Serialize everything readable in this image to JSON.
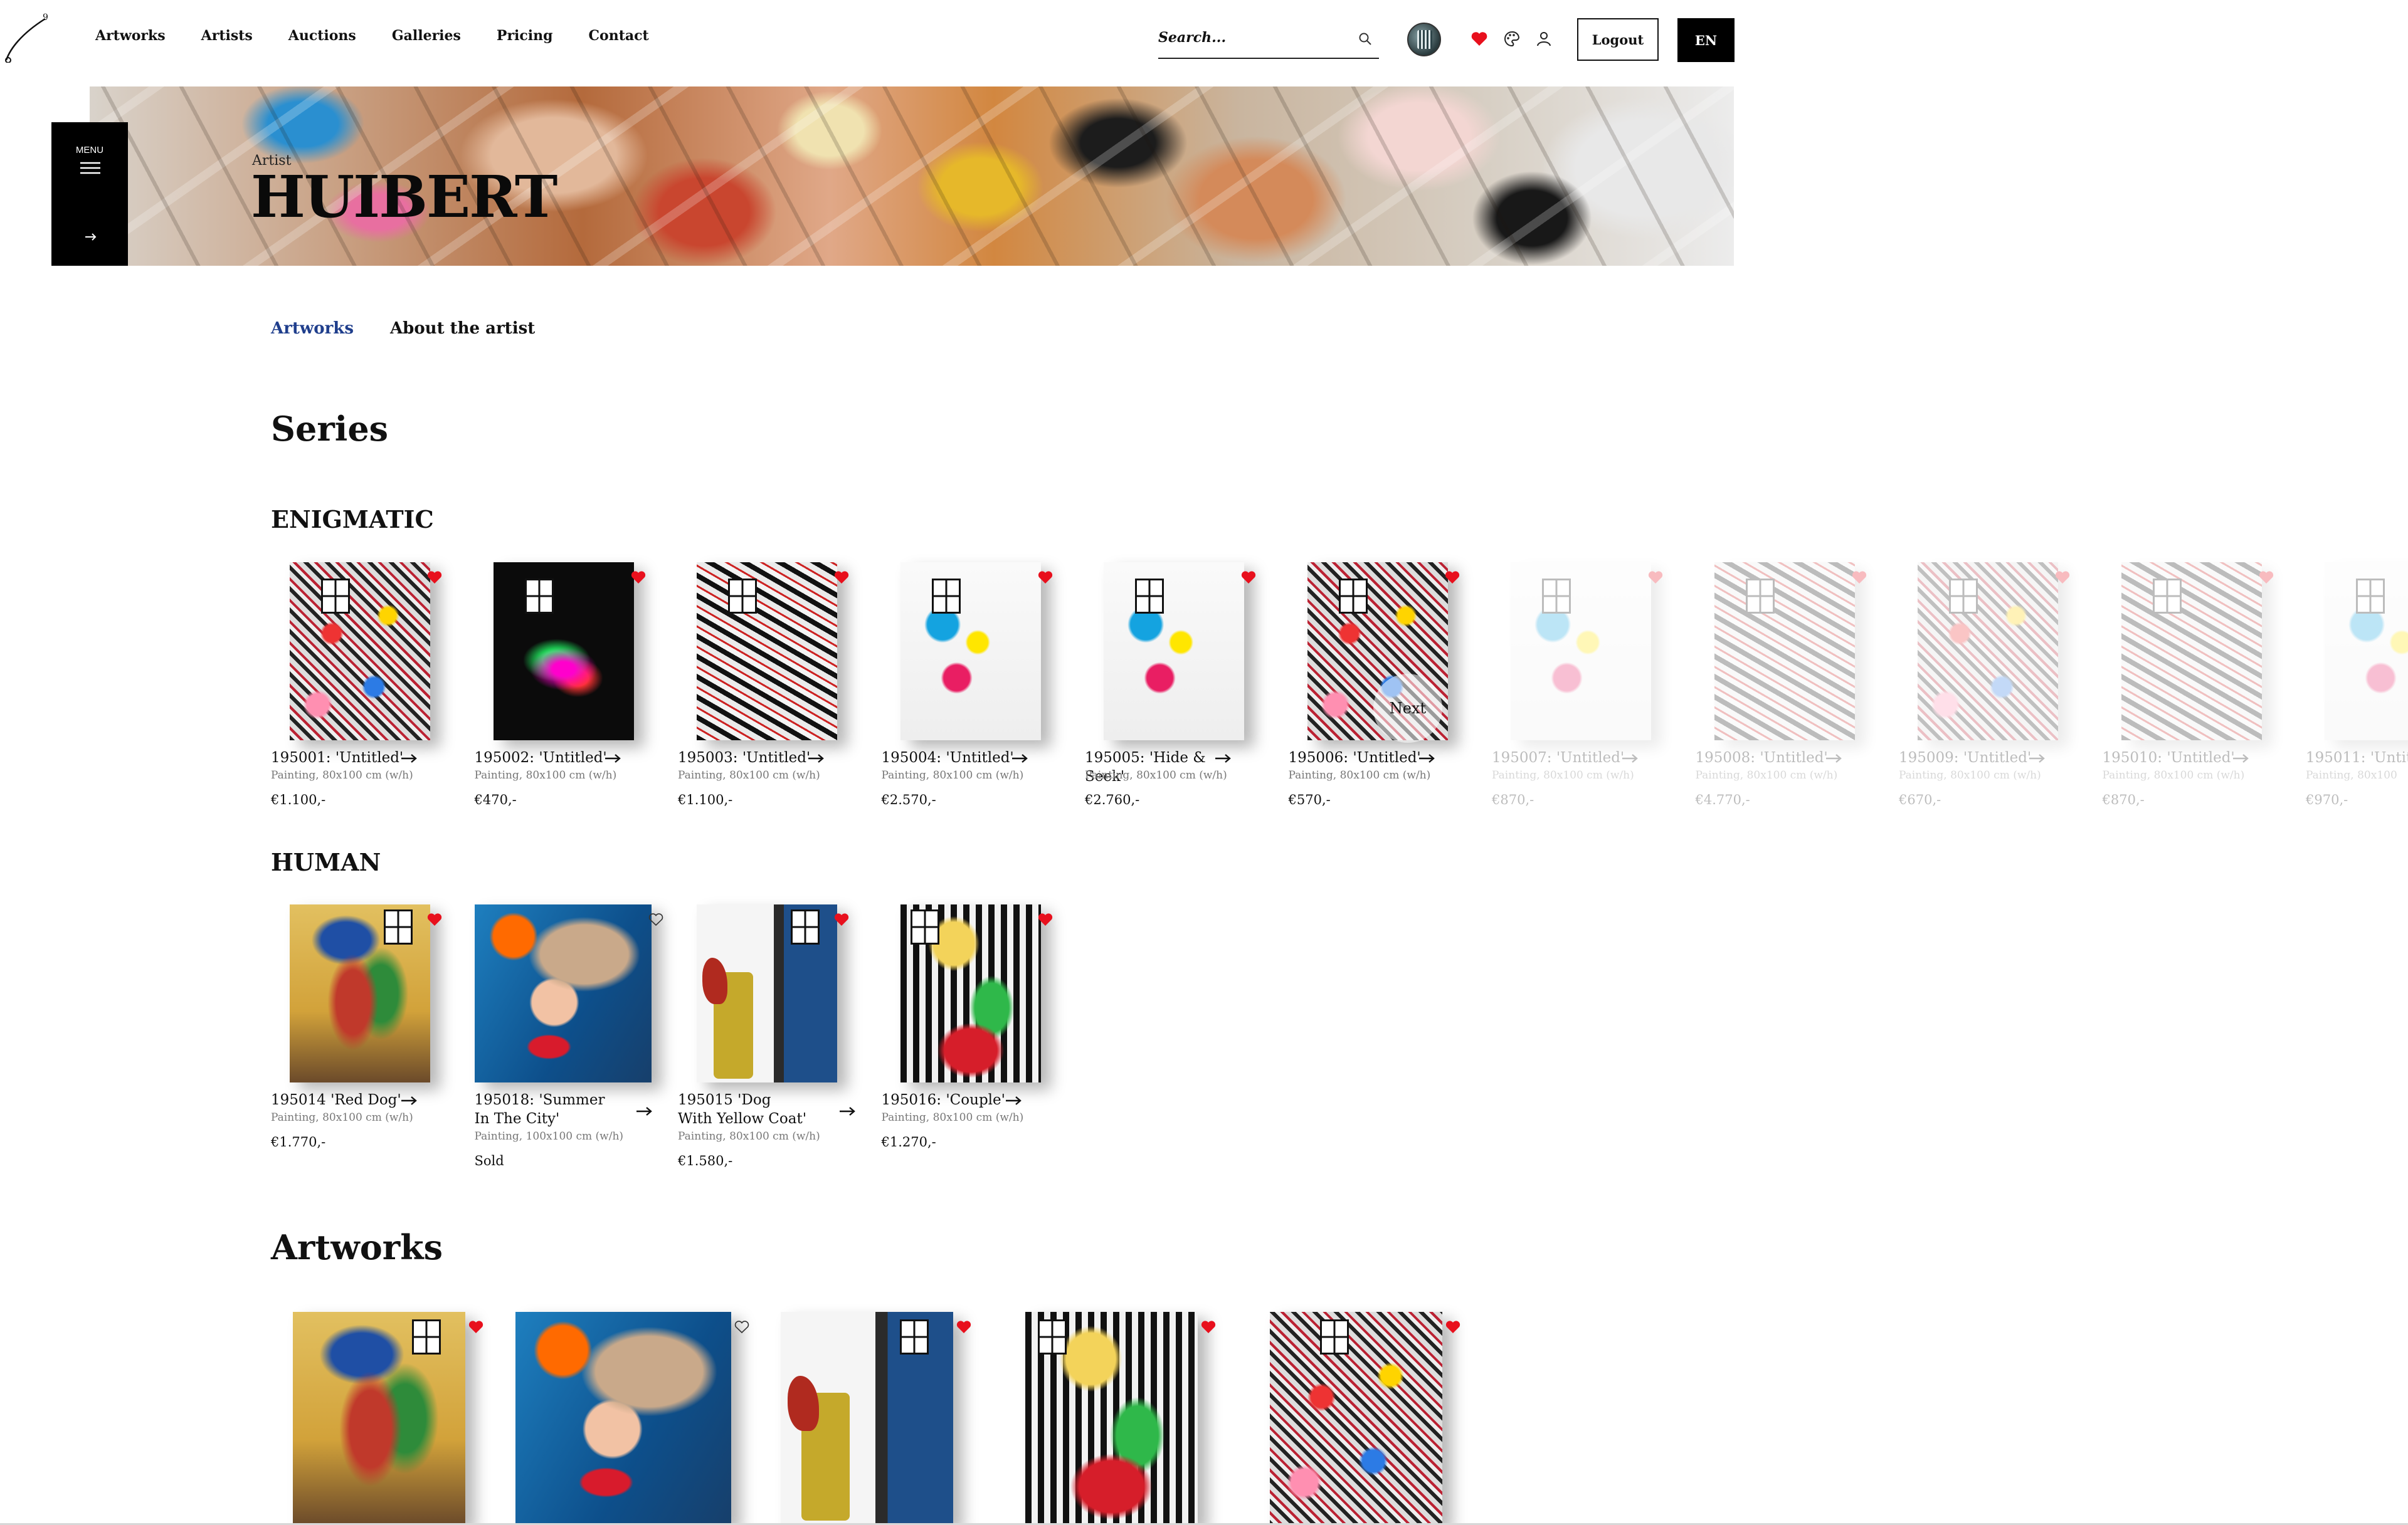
{
  "nav": {
    "items": [
      "Artworks",
      "Artists",
      "Auctions",
      "Galleries",
      "Pricing",
      "Contact"
    ],
    "search_placeholder": "Search...",
    "logout": "Logout",
    "lang": "EN",
    "logo_superscript": "9"
  },
  "banner": {
    "label": "Artist",
    "title": "HUIBERT",
    "menu_label": "MENU"
  },
  "subtabs": {
    "artworks": "Artworks",
    "about": "About the artist"
  },
  "sections": {
    "series": "Series",
    "enigmatic": "ENIGMATIC",
    "human": "HUMAN",
    "artworks": "Artworks"
  },
  "next_hint": "Next",
  "enigmatic": [
    {
      "title": "195001: 'Untitled'",
      "meta": "Painting, 80x100 cm (w/h)",
      "price": "€1.100,-",
      "fav": true
    },
    {
      "title": "195002: 'Untitled'",
      "meta": "Painting, 80x100 cm (w/h)",
      "price": "€470,-",
      "fav": true
    },
    {
      "title": "195003: 'Untitled'",
      "meta": "Painting, 80x100 cm (w/h)",
      "price": "€1.100,-",
      "fav": true
    },
    {
      "title": "195004: 'Untitled'",
      "meta": "Painting, 80x100 cm (w/h)",
      "price": "€2.570,-",
      "fav": true
    },
    {
      "title": "195005: 'Hide & Seek'",
      "meta": "Painting, 80x100 cm (w/h)",
      "price": "€2.760,-",
      "fav": true
    },
    {
      "title": "195006: 'Untitled'",
      "meta": "Painting, 80x100 cm (w/h)",
      "price": "€570,-",
      "fav": true
    },
    {
      "title": "195007: 'Untitled'",
      "meta": "Painting, 80x100 cm (w/h)",
      "price": "€870,-",
      "fav": true
    },
    {
      "title": "195008: 'Untitled'",
      "meta": "Painting, 80x100 cm (w/h)",
      "price": "€4.770,-",
      "fav": true
    },
    {
      "title": "195009: 'Untitled'",
      "meta": "Painting, 80x100 cm (w/h)",
      "price": "€670,-",
      "fav": true
    },
    {
      "title": "195010: 'Untitled'",
      "meta": "Painting, 80x100 cm (w/h)",
      "price": "€870,-",
      "fav": true
    },
    {
      "title": "195011: 'Untitle",
      "meta": "Painting, 80x100",
      "price": "€970,-",
      "fav": false
    }
  ],
  "human": [
    {
      "title": "195014 'Red Dog'",
      "meta": "Painting, 80x100 cm (w/h)",
      "price": "€1.770,-",
      "fav": true
    },
    {
      "title": "195018: 'Summer In The City'",
      "meta": "Painting, 100x100 cm (w/h)",
      "price": "Sold",
      "fav": false
    },
    {
      "title": "195015 'Dog With Yellow Coat'",
      "meta": "Painting, 80x100 cm (w/h)",
      "price": "€1.580,-",
      "fav": true
    },
    {
      "title": "195016: 'Couple'",
      "meta": "Painting, 80x100 cm (w/h)",
      "price": "€1.270,-",
      "fav": true
    }
  ],
  "artworks_favs": [
    true,
    false,
    true,
    true,
    true
  ],
  "colors": {
    "accent_blue": "#1f3e8c",
    "fav_red": "#e8101d",
    "black": "#000000"
  }
}
